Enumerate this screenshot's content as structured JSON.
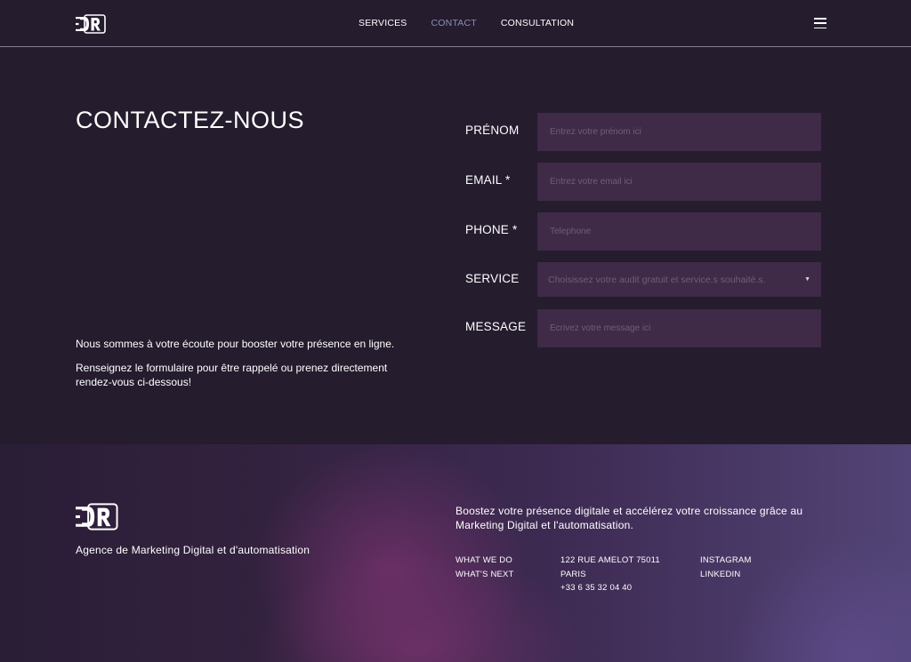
{
  "header": {
    "logo_text": "DR",
    "nav": [
      {
        "label": "SERVICES",
        "active": false
      },
      {
        "label": "CONTACT",
        "active": true
      },
      {
        "label": "CONSULTATION",
        "active": false
      }
    ],
    "menu_icon": "hamburger-icon"
  },
  "main": {
    "title": "CONTACTEZ-NOUS",
    "intro_1": "Nous sommes à votre écoute pour booster votre présence en ligne.",
    "intro_2": "Renseignez le formulaire pour être rappelé ou prenez directement rendez-vous ci-dessous!"
  },
  "form": {
    "firstname": {
      "label": "PRÉNOM",
      "placeholder": "Entrez votre prénom ici",
      "value": ""
    },
    "email": {
      "label": "EMAIL *",
      "placeholder": "Entrez votre email ici",
      "value": ""
    },
    "phone": {
      "label": "PHONE *",
      "placeholder": "Telephone",
      "value": ""
    },
    "service": {
      "label": "SERVICE",
      "selected": "Choisissez votre audit gratuit et service.s souhaité.s."
    },
    "message": {
      "label": "MESSAGE",
      "placeholder": "Écrivez votre message ici",
      "value": ""
    }
  },
  "footer": {
    "logo_text": "DR",
    "tagline": "Agence de Marketing Digital et d'automatisation",
    "pitch": "Boostez votre présence digitale et accélérez votre croissance grâce au Marketing Digital et l'automatisation.",
    "links_col1": [
      "WHAT WE DO",
      "WHAT'S NEXT"
    ],
    "address": [
      "122 RUE AMELOT 75011",
      "PARIS",
      "+33 6 35 32 04 40"
    ],
    "social": [
      "INSTAGRAM",
      "LINKEDIN"
    ]
  },
  "colors": {
    "background": "#251c2e",
    "field_bg": "#3f2a47",
    "nav_active": "#8d8fb6"
  }
}
